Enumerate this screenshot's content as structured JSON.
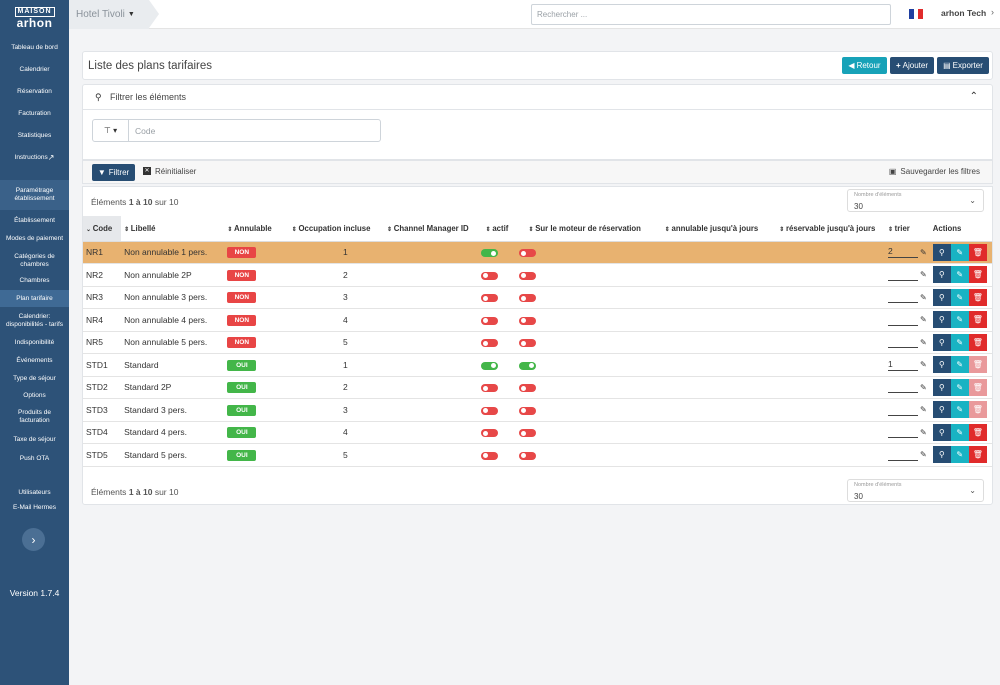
{
  "sidebar": {
    "logo_top": "MAISON",
    "logo_main": "arhon",
    "items": [
      {
        "label": "Tableau de bord"
      },
      {
        "label": "Calendrier"
      },
      {
        "label": "Réservation"
      },
      {
        "label": "Facturation"
      },
      {
        "label": "Statistiques"
      },
      {
        "label": "Instructions"
      },
      {
        "label": "Paramétrage établissement"
      },
      {
        "label": "Établissement"
      },
      {
        "label": "Modes de paiement"
      },
      {
        "label": "Catégories de chambres"
      },
      {
        "label": "Chambres"
      },
      {
        "label": "Plan tarifaire"
      },
      {
        "label": "Calendrier: disponibilités - tarifs"
      },
      {
        "label": "Indisponibilité"
      },
      {
        "label": "Événements"
      },
      {
        "label": "Type de séjour"
      },
      {
        "label": "Options"
      },
      {
        "label": "Produits de facturation"
      },
      {
        "label": "Taxe de séjour"
      },
      {
        "label": "Push OTA"
      },
      {
        "label": "Utilisateurs"
      },
      {
        "label": "E-Mail Hermes"
      }
    ],
    "version": "Version 1.7.4"
  },
  "topbar": {
    "hotel": "Hotel Tivoli",
    "search_placeholder": "Rechercher ...",
    "user": "arhon Tech"
  },
  "header": {
    "title": "Liste des plans tarifaires",
    "btn_back": "Retour",
    "btn_add": "Ajouter",
    "btn_export": "Exporter"
  },
  "filters": {
    "title": "Filtrer les éléments",
    "code_placeholder": "Code",
    "btn_filter": "Filtrer",
    "btn_reset": "Réinitialiser",
    "btn_save": "Sauvegarder les filtres"
  },
  "pagination": {
    "prefix": "Éléments",
    "range": "1 à 10",
    "suffix": "sur 10",
    "per_page_label": "Nombre d'éléments",
    "per_page": "30"
  },
  "table": {
    "columns": [
      "Code",
      "Libellé",
      "Annulable",
      "Occupation incluse",
      "Channel Manager ID",
      "actif",
      "Sur le moteur de réservation",
      "annulable jusqu'à jours",
      "réservable jusqu'à jours",
      "trier",
      "Actions"
    ],
    "rows": [
      {
        "code": "NR1",
        "label": "Non annulable 1 pers.",
        "annulable": "NON",
        "occ": "1",
        "actif": true,
        "moteur": false,
        "trier": "2",
        "deletable": true
      },
      {
        "code": "NR2",
        "label": "Non annulable 2P",
        "annulable": "NON",
        "occ": "2",
        "actif": false,
        "moteur": false,
        "trier": "",
        "deletable": true
      },
      {
        "code": "NR3",
        "label": "Non annulable 3 pers.",
        "annulable": "NON",
        "occ": "3",
        "actif": false,
        "moteur": false,
        "trier": "",
        "deletable": true
      },
      {
        "code": "NR4",
        "label": "Non annulable 4 pers.",
        "annulable": "NON",
        "occ": "4",
        "actif": false,
        "moteur": false,
        "trier": "",
        "deletable": true
      },
      {
        "code": "NR5",
        "label": "Non annulable 5 pers.",
        "annulable": "NON",
        "occ": "5",
        "actif": false,
        "moteur": false,
        "trier": "",
        "deletable": true
      },
      {
        "code": "STD1",
        "label": "Standard",
        "annulable": "OUI",
        "occ": "1",
        "actif": true,
        "moteur": true,
        "trier": "1",
        "deletable": false
      },
      {
        "code": "STD2",
        "label": "Standard 2P",
        "annulable": "OUI",
        "occ": "2",
        "actif": false,
        "moteur": false,
        "trier": "",
        "deletable": false
      },
      {
        "code": "STD3",
        "label": "Standard 3 pers.",
        "annulable": "OUI",
        "occ": "3",
        "actif": false,
        "moteur": false,
        "trier": "",
        "deletable": false
      },
      {
        "code": "STD4",
        "label": "Standard 4 pers.",
        "annulable": "OUI",
        "occ": "4",
        "actif": false,
        "moteur": false,
        "trier": "",
        "deletable": true
      },
      {
        "code": "STD5",
        "label": "Standard 5 pers.",
        "annulable": "OUI",
        "occ": "5",
        "actif": false,
        "moteur": false,
        "trier": "",
        "deletable": true
      }
    ]
  }
}
